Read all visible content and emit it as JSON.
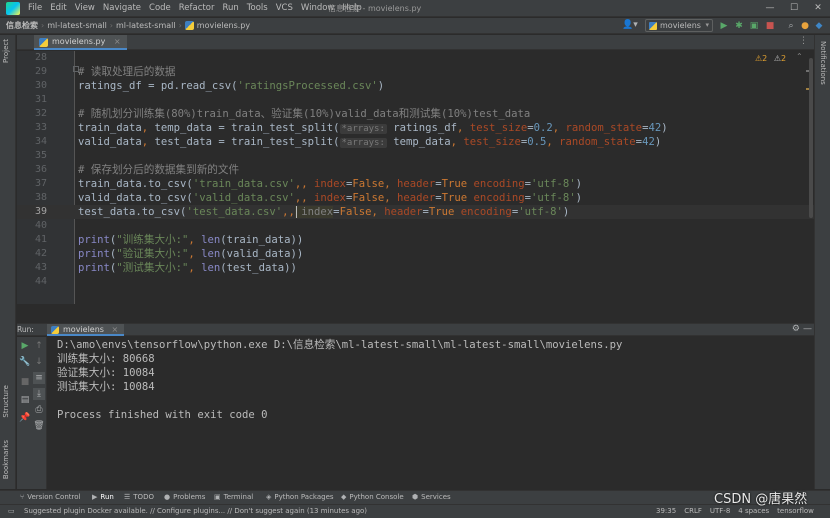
{
  "window": {
    "title": "信息检索 - movielens.py",
    "menu": [
      "File",
      "Edit",
      "View",
      "Navigate",
      "Code",
      "Refactor",
      "Run",
      "Tools",
      "VCS",
      "Window",
      "Help"
    ]
  },
  "navbar": {
    "breadcrumb": [
      "信息检索",
      "ml-latest-small",
      "ml-latest-small",
      "movielens.py"
    ],
    "run_config": "movielens"
  },
  "left_strip": {
    "project": "Project",
    "structure": "Structure",
    "bookmarks": "Bookmarks"
  },
  "right_strip": {
    "notifications": "Notifications"
  },
  "editor": {
    "tab": "movielens.py",
    "inspections": {
      "warnings": "2",
      "weak_warnings": "2"
    },
    "current_line": "39",
    "lines": [
      {
        "n": "28"
      },
      {
        "n": "29",
        "comment": "# 读取处理后的数据"
      },
      {
        "n": "30",
        "a": "ratings_df = pd.read_csv(",
        "s": "'ratingsProcessed.csv'",
        "b": ")"
      },
      {
        "n": "31"
      },
      {
        "n": "32",
        "comment": "# 随机划分训练集(80%)train_data、验证集(10%)valid_data和测试集(10%)test_data"
      },
      {
        "n": "33",
        "a": "train_data",
        "k1": ",",
        "a2": " temp_data = train_test_split(",
        "hint": "*arrays:",
        "a3": " ratings_df",
        "k2": ",",
        "p1": " test_size",
        "eq1": "=",
        "num1": "0.2",
        "k3": ",",
        "p2": " random_state",
        "eq2": "=",
        "num2": "42",
        "b": ")"
      },
      {
        "n": "34",
        "a": "valid_data",
        "k1": ",",
        "a2": " test_data = train_test_split(",
        "hint": "*arrays:",
        "a3": " temp_data",
        "k2": ",",
        "p1": " test_size",
        "eq1": "=",
        "num1": "0.5",
        "k3": ",",
        "p2": " random_state",
        "eq2": "=",
        "num2": "42",
        "b": ")"
      },
      {
        "n": "35"
      },
      {
        "n": "36",
        "comment": "# 保存划分后的数据集到新的文件"
      },
      {
        "n": "37",
        "a": "train_data.to_csv(",
        "s": "'train_data.csv'",
        "k1": ",",
        "p1": " index",
        "eq1": "=",
        "kw1": "False",
        "k2": ",",
        "p2": " header",
        "eq2": "=",
        "kw2": "True",
        "k3": ",",
        "p3": " encoding",
        "eq3": "=",
        "s2": "'utf-8'",
        "b": ")"
      },
      {
        "n": "38",
        "a": "valid_data.to_csv(",
        "s": "'valid_data.csv'",
        "k1": ",",
        "p1": " index",
        "eq1": "=",
        "kw1": "False",
        "k2": ",",
        "p2": " header",
        "eq2": "=",
        "kw2": "True",
        "k3": ",",
        "p3": " encoding",
        "eq3": "=",
        "s2": "'utf-8'",
        "b": ")"
      },
      {
        "n": "39",
        "a": "test_data.to_csv(",
        "s": "'test_data.csv'",
        "k1": ",",
        "p1": " index",
        "eq1": "=",
        "kw1": "False",
        "k2": ",",
        "p2": " header",
        "eq2": "=",
        "kw2": "True",
        "k3": ",",
        "p3": " encoding",
        "eq3": "=",
        "s2": "'utf-8'",
        "b": ")"
      },
      {
        "n": "40"
      },
      {
        "n": "41",
        "f": "print",
        "a": "(",
        "s": "\"训练集大小:\"",
        "k1": ",",
        "f2": " len",
        "b": "(train_data))"
      },
      {
        "n": "42",
        "f": "print",
        "a": "(",
        "s": "\"验证集大小:\"",
        "k1": ",",
        "f2": " len",
        "b": "(valid_data))"
      },
      {
        "n": "43",
        "f": "print",
        "a": "(",
        "s": "\"测试集大小:\"",
        "k1": ",",
        "f2": " len",
        "b": "(test_data))"
      },
      {
        "n": "44"
      }
    ]
  },
  "run": {
    "label": "Run:",
    "tab": "movielens",
    "console": [
      "D:\\amo\\envs\\tensorflow\\python.exe D:\\信息检索\\ml-latest-small\\ml-latest-small\\movielens.py",
      "训练集大小: 80668",
      "验证集大小: 10084",
      "测试集大小: 10084",
      "",
      "Process finished with exit code 0"
    ]
  },
  "bottom_tools": [
    {
      "label": "Version Control",
      "icon": "branch-icon"
    },
    {
      "label": "Run",
      "icon": "play-icon"
    },
    {
      "label": "TODO",
      "icon": "list-icon"
    },
    {
      "label": "Problems",
      "icon": "problems-icon"
    },
    {
      "label": "Terminal",
      "icon": "terminal-icon"
    },
    {
      "label": "Python Packages",
      "icon": "packages-icon"
    },
    {
      "label": "Python Console",
      "icon": "python-icon"
    },
    {
      "label": "Services",
      "icon": "services-icon"
    }
  ],
  "status": {
    "message": "Suggested plugin Docker available. // Configure plugins... // Don't suggest again (13 minutes ago)",
    "position": "39:35",
    "line_sep": "CRLF",
    "encoding": "UTF-8",
    "indent": "4 spaces",
    "interpreter": "tensorflow"
  },
  "watermark": "CSDN @唐果然",
  "colors": {
    "accent": "#4a88c7",
    "bg": "#2b2b2b",
    "panel": "#3c3f41"
  }
}
